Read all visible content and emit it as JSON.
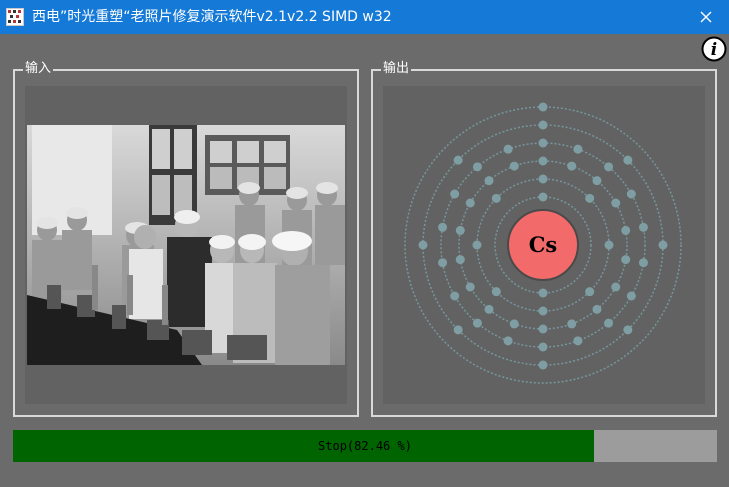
{
  "window": {
    "title": "西电”时光重塑“老照片修复演示软件v2.1v2.2 SIMD w32",
    "close_symbol": "✕"
  },
  "icons": {
    "app": "app-logo-icon",
    "close": "close-icon",
    "info": "info-icon"
  },
  "input_panel": {
    "label": "输入",
    "image_description_icon": "old-photo"
  },
  "output_panel": {
    "label": "输出",
    "element_symbol": "Cs",
    "shell_electrons": [
      2,
      8,
      18,
      18,
      8,
      1
    ]
  },
  "info_button": {
    "label": "i"
  },
  "progress": {
    "status_text": "Stop(82.46 %)",
    "percent": 82.46
  },
  "colors": {
    "titlebar": "#1479d7",
    "background": "#6b6b6b",
    "progress_fill": "#006400",
    "nucleus": "#f36a6a"
  }
}
